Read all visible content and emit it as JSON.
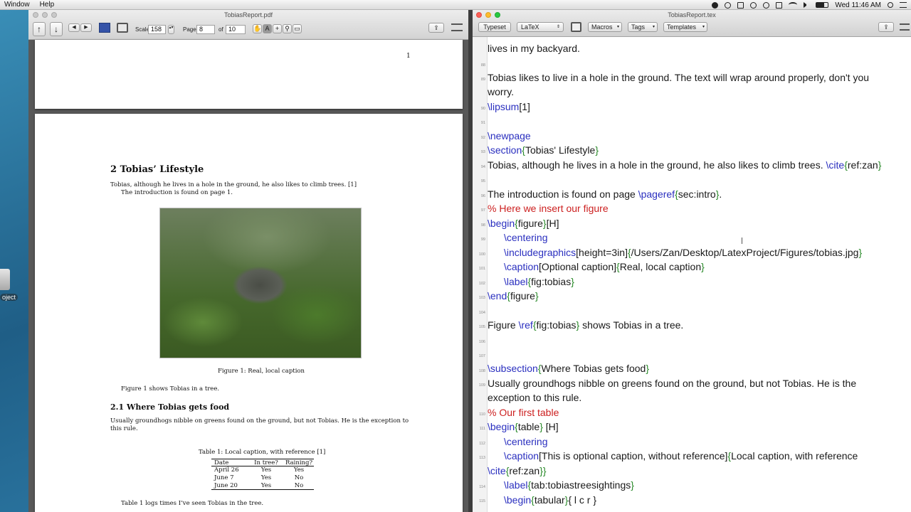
{
  "menubar": {
    "items": [
      "Window",
      "Help"
    ],
    "clock": "Wed 11:46 AM"
  },
  "desktop": {
    "icon_label": "oject"
  },
  "pdf": {
    "title": "TobiasReport.pdf",
    "scale_label": "Scale",
    "scale_value": "158",
    "page_label": "Page",
    "page_value": "8",
    "of_label": "of",
    "of_value": "10",
    "page1_number": "1",
    "section_title": "2    Tobias’ Lifestyle",
    "para1": "Tobias, although he lives in a hole in the ground, he also likes to climb trees. [1]",
    "para2": "The introduction is found on page 1.",
    "figure_caption": "Figure 1:  Real, local caption",
    "figure_ref": "Figure 1 shows Tobias in a tree.",
    "subsection_title": "2.1    Where Tobias gets food",
    "food_para_1": "Usually groundhogs nibble on greens found on the ground, but not Tobias.  He is the exception to",
    "food_para_2": "this rule.",
    "table_caption": "Table 1: Local caption, with reference [1]",
    "table": {
      "headers": [
        "Date",
        "In tree?",
        "Raining?"
      ],
      "rows": [
        [
          "April 26",
          "Yes",
          "Yes"
        ],
        [
          "June 7",
          "Yes",
          "No"
        ],
        [
          "June 20",
          "Yes",
          "No"
        ]
      ]
    },
    "table_ref": "Table 1 logs times I’ve seen Tobias in the tree."
  },
  "editor": {
    "title": "TobiasReport.tex",
    "typeset_label": "Typeset",
    "engine_label": "LaTeX",
    "macros_label": "Macros",
    "tags_label": "Tags",
    "templates_label": "Templates",
    "lines": {
      "l88a": "lives in my backyard.",
      "n88": "88",
      "n89": "89",
      "l89a": "Tobias likes to live in a hole in the ground. The text will wrap around properly, don't you",
      "l89b": "worry.",
      "n90": "90",
      "c90": "\\lipsum",
      "a90": "[1]",
      "n91": "91",
      "n92": "92",
      "c92": "\\newpage",
      "n93": "93",
      "c93": "\\section",
      "a93o": "{",
      "a93": "Tobias' Lifestyle",
      "a93c": "}",
      "n94": "94",
      "t94": "Tobias, although he lives in a hole in the ground, he also likes to climb trees. ",
      "c94": "\\cite",
      "a94o": "{",
      "a94": "ref:zan",
      "a94c": "}",
      "n95": "95",
      "n96": "96",
      "t96": "The introduction is found on page ",
      "c96": "\\pageref",
      "a96o": "{",
      "a96": "sec:intro",
      "a96c": "}",
      "t96e": ".",
      "n97": "97",
      "t97": "% Here we insert our figure",
      "n98": "98",
      "c98": "\\begin",
      "a98o": "{",
      "a98": "figure",
      "a98c": "}",
      "t98e": "[H]",
      "n99": "99",
      "c99": "\\centering",
      "n100": "100",
      "c100": "\\includegraphics",
      "t100": "[height=3in]",
      "a100o": "{",
      "a100": "/Users/Zan/Desktop/LatexProject/Figures/tobias.jpg",
      "a100c": "}",
      "n101": "101",
      "c101": "\\caption",
      "t101": "[Optional caption]",
      "a101o": "{",
      "a101": "Real, local caption",
      "a101c": "}",
      "n102": "102",
      "c102": "\\label",
      "a102o": "{",
      "a102": "fig:tobias",
      "a102c": "}",
      "n103": "103",
      "c103": "\\end",
      "a103o": "{",
      "a103": "figure",
      "a103c": "}",
      "n104": "104",
      "n105": "105",
      "t105": "Figure ",
      "c105": "\\ref",
      "a105o": "{",
      "a105": "fig:tobias",
      "a105c": "}",
      "t105e": " shows Tobias in a tree.",
      "n106": "106",
      "n107": "107",
      "n108": "108",
      "c108": "\\subsection",
      "a108o": "{",
      "a108": "Where Tobias gets food",
      "a108c": "}",
      "n109": "109",
      "t109a": "Usually groundhogs nibble on greens found on the ground, but not Tobias. He is the",
      "t109b": "exception to this rule.",
      "n110": "110",
      "t110": "% Our first table",
      "n111": "111",
      "c111": "\\begin",
      "a111o": "{",
      "a111": "table",
      "a111c": "}",
      "t111e": " [H]",
      "n112": "112",
      "c112": "\\centering",
      "n113": "113",
      "c113": "\\caption",
      "t113": "[This is optional caption, without reference]",
      "a113o": "{",
      "a113": "Local caption, with reference",
      "c113b": "\\cite",
      "a113b": "ref:zan",
      "a113bc": "}}",
      "n114": "114",
      "c114": "\\label",
      "a114o": "{",
      "a114": "tab:tobiastreesightings",
      "a114c": "}",
      "n115": "115",
      "c115": "\\begin",
      "a115o": "{",
      "a115": "tabular",
      "a115c": "}",
      "a115b": "{ l c r }"
    }
  },
  "colors": {
    "command": "#2a2fbf",
    "argument": "#2a8a2a",
    "comment": "#cc1f1f"
  }
}
